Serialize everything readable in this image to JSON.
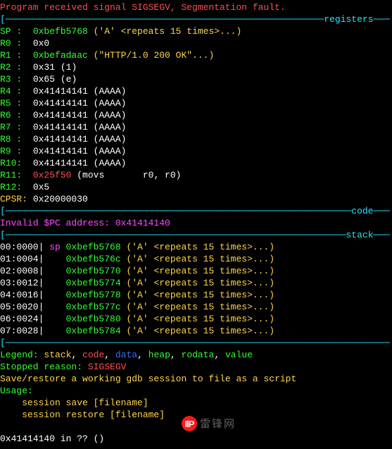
{
  "header": "Program received signal SIGSEGV, Segmentation fault.",
  "sections": {
    "registers": "registers",
    "code": "code",
    "stack": "stack"
  },
  "registers": [
    {
      "name": "SP",
      "sep": " :",
      "val": "0xbefb5768",
      "ann": "('A' <repeats 15 times>...)",
      "valColor": "green",
      "annColor": "yellow"
    },
    {
      "name": "R0",
      "sep": " :",
      "val": "0x0",
      "ann": "",
      "valColor": "white",
      "annColor": "white"
    },
    {
      "name": "R1",
      "sep": " :",
      "val": "0xbefadaac",
      "ann": "(\"HTTP/1.0 200 OK\"...)",
      "valColor": "green",
      "annColor": "yellow"
    },
    {
      "name": "R2",
      "sep": " :",
      "val": "0x31",
      "ann": "(1)",
      "valColor": "white",
      "annColor": "white"
    },
    {
      "name": "R3",
      "sep": " :",
      "val": "0x65",
      "ann": "(e)",
      "valColor": "white",
      "annColor": "white"
    },
    {
      "name": "R4",
      "sep": " :",
      "val": "0x41414141",
      "ann": "(AAAA)",
      "valColor": "white",
      "annColor": "white"
    },
    {
      "name": "R5",
      "sep": " :",
      "val": "0x41414141",
      "ann": "(AAAA)",
      "valColor": "white",
      "annColor": "white"
    },
    {
      "name": "R6",
      "sep": " :",
      "val": "0x41414141",
      "ann": "(AAAA)",
      "valColor": "white",
      "annColor": "white"
    },
    {
      "name": "R7",
      "sep": " :",
      "val": "0x41414141",
      "ann": "(AAAA)",
      "valColor": "white",
      "annColor": "white"
    },
    {
      "name": "R8",
      "sep": " :",
      "val": "0x41414141",
      "ann": "(AAAA)",
      "valColor": "white",
      "annColor": "white"
    },
    {
      "name": "R9",
      "sep": " :",
      "val": "0x41414141",
      "ann": "(AAAA)",
      "valColor": "white",
      "annColor": "white"
    },
    {
      "name": "R10",
      "sep": ":",
      "val": "0x41414141",
      "ann": "(AAAA)",
      "valColor": "white",
      "annColor": "white"
    },
    {
      "name": "R11",
      "sep": ":",
      "val": "0x25f50",
      "ann": "(movs       r0, r0)",
      "valColor": "red",
      "annColor": "white"
    },
    {
      "name": "R12",
      "sep": ":",
      "val": "0x5",
      "ann": "",
      "valColor": "white",
      "annColor": "white"
    },
    {
      "name": "CPSR",
      "sep": ":",
      "val": "0x20000030",
      "ann": "",
      "valColor": "white",
      "annColor": "white",
      "nameColor": "yellow"
    }
  ],
  "invalid_pc": {
    "label": "Invalid $PC address: ",
    "addr": "0x41414140"
  },
  "stack": [
    {
      "idx": "00:0000|",
      "sym": "sp",
      "addr": "0xbefb5768",
      "ann": "('A' <repeats 15 times>...)"
    },
    {
      "idx": "01:0004|",
      "sym": "  ",
      "addr": "0xbefb576c",
      "ann": "('A' <repeats 15 times>...)"
    },
    {
      "idx": "02:0008|",
      "sym": "  ",
      "addr": "0xbefb5770",
      "ann": "('A' <repeats 15 times>...)"
    },
    {
      "idx": "03:0012|",
      "sym": "  ",
      "addr": "0xbefb5774",
      "ann": "('A' <repeats 15 times>...)"
    },
    {
      "idx": "04:0016|",
      "sym": "  ",
      "addr": "0xbefb5778",
      "ann": "('A' <repeats 15 times>...)"
    },
    {
      "idx": "05:0020|",
      "sym": "  ",
      "addr": "0xbefb577c",
      "ann": "('A' <repeats 15 times>...)"
    },
    {
      "idx": "06:0024|",
      "sym": "  ",
      "addr": "0xbefb5780",
      "ann": "('A' <repeats 15 times>...)"
    },
    {
      "idx": "07:0028|",
      "sym": "  ",
      "addr": "0xbefb5784",
      "ann": "('A' <repeats 15 times>...)"
    }
  ],
  "legend": {
    "prefix": "Legend: ",
    "stack": "stack",
    "code": "code",
    "data": "data",
    "heap": "heap",
    "rodata": "rodata",
    "value": "value"
  },
  "stopped": {
    "label": "Stopped reason: ",
    "value": "SIGSEGV"
  },
  "hint1": "Save/restore a working gdb session to file as a script",
  "usage": "Usage:",
  "usage_lines": [
    "    session save [filename]",
    "    session restore [filename]"
  ],
  "bottom": "0x41414140 in ?? ()",
  "watermark": {
    "badge": "IlP",
    "text": "雷锋网"
  }
}
